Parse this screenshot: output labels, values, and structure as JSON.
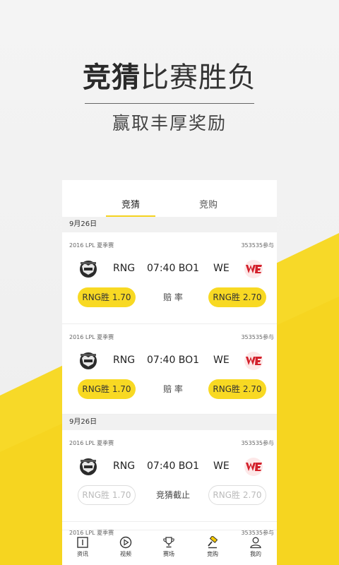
{
  "promo": {
    "title_bold": "竞猜",
    "title_light": "比赛胜负",
    "subtitle": "赢取丰厚奖励"
  },
  "tabs": [
    {
      "label": "竞猜",
      "active": true
    },
    {
      "label": "竞购",
      "active": false
    }
  ],
  "groups": [
    {
      "date": "9月26日",
      "matches": [
        {
          "league": "2016 LPL 夏季赛",
          "participants": "353535参与",
          "team1": "RNG",
          "team2": "WE",
          "time": "07:40 BO1",
          "bet1": "RNG胜 1.70",
          "bet2": "RNG胜 2.70",
          "mid": "赔 率",
          "closed": false
        },
        {
          "league": "2016 LPL 夏季赛",
          "participants": "353535参与",
          "team1": "RNG",
          "team2": "WE",
          "time": "07:40 BO1",
          "bet1": "RNG胜 1.70",
          "bet2": "RNG胜 2.70",
          "mid": "赔 率",
          "closed": false
        }
      ]
    },
    {
      "date": "9月26日",
      "matches": [
        {
          "league": "2016 LPL 夏季赛",
          "participants": "353535参与",
          "team1": "RNG",
          "team2": "WE",
          "time": "07:40 BO1",
          "bet1": "RNG胜 1.70",
          "bet2": "RNG胜 2.70",
          "mid": "竞猜截止",
          "closed": true
        }
      ]
    }
  ],
  "peek": {
    "league": "2016 LPL 夏季赛",
    "participants": "353535参与"
  },
  "nav": [
    {
      "label": "资讯",
      "icon": "news-icon"
    },
    {
      "label": "视频",
      "icon": "video-icon"
    },
    {
      "label": "赛场",
      "icon": "trophy-icon"
    },
    {
      "label": "竞购",
      "icon": "gavel-icon"
    },
    {
      "label": "我的",
      "icon": "person-icon"
    }
  ],
  "colors": {
    "accent": "#f8d923",
    "background": "#f0f0f0"
  }
}
